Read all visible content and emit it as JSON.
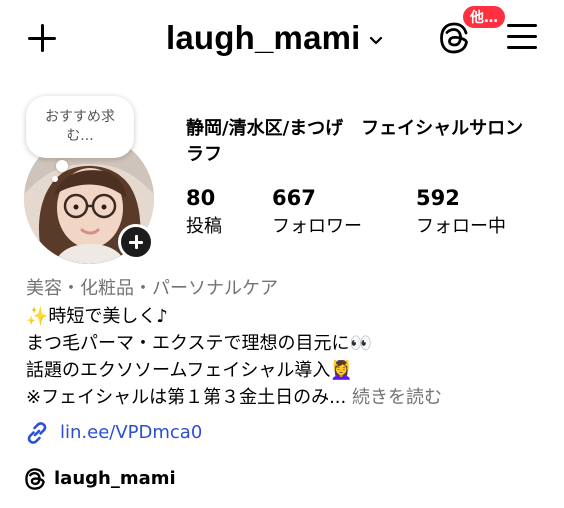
{
  "header": {
    "username": "laugh_mami",
    "badge_label": "他…"
  },
  "note": {
    "text": "おすすめ求む..."
  },
  "profile": {
    "name": "静岡/清水区/まつげ　フェイシャルサロン　ラフ",
    "stats": [
      {
        "value": "80",
        "label": "投稿"
      },
      {
        "value": "667",
        "label": "フォロワー"
      },
      {
        "value": "592",
        "label": "フォロー中"
      }
    ]
  },
  "bio": {
    "category": "美容・化粧品・パーソナルケア",
    "line1": "時短で美しく♪",
    "line1_emoji": "✨",
    "line2": "まつ毛パーマ・エクステで理想の目元に",
    "line2_emoji": "👀",
    "line3": "話題のエクソソームフェイシャル導入",
    "line3_emoji": "💆‍♀️",
    "line4": "※フェイシャルは第１第３金土日のみ...",
    "more_label": "続きを読む",
    "link": "lin.ee/VPDmca0",
    "threads_handle": "laugh_mami"
  },
  "icons": {
    "plus": "plus-icon",
    "chevron": "chevron-down-icon",
    "threads": "threads-icon",
    "menu": "hamburger-menu-icon",
    "link": "link-icon",
    "add_story": "add-story-icon"
  },
  "colors": {
    "badge": "#ff3040",
    "link": "#2b4fd6",
    "secondary_text": "#737373"
  }
}
